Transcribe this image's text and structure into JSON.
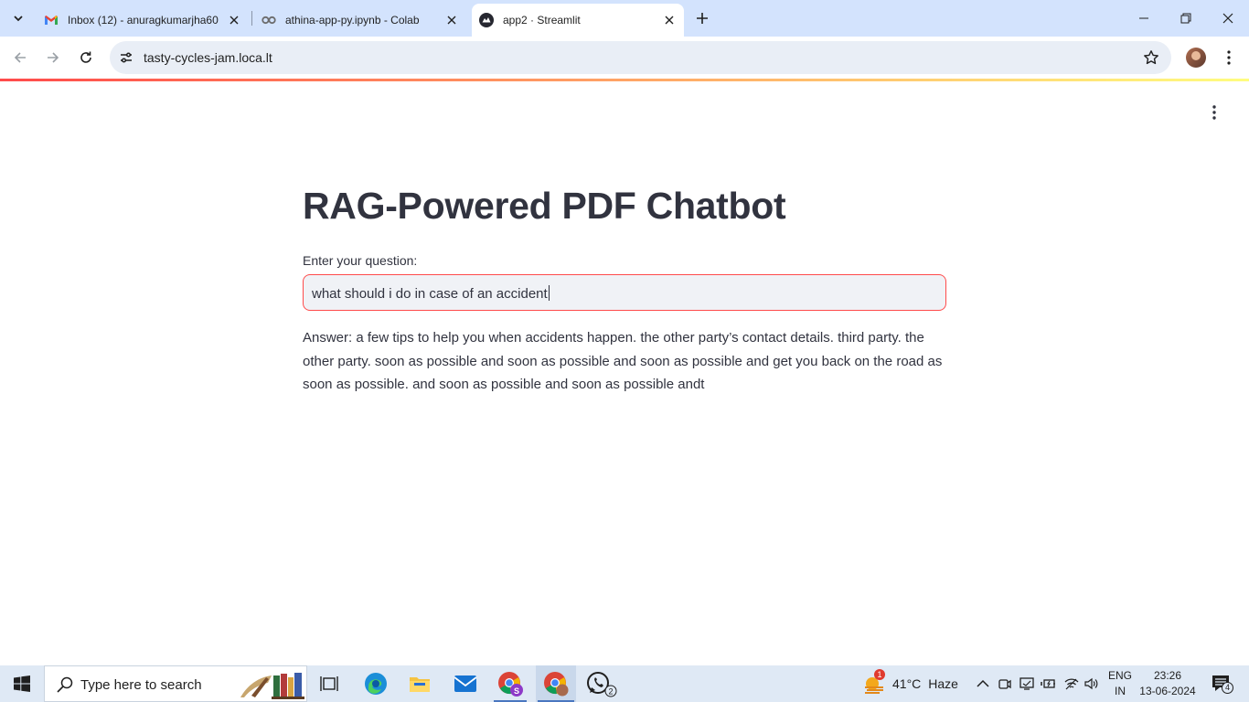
{
  "browser": {
    "tabs": [
      {
        "title": "Inbox (12) - anuragkumarjha60",
        "icon": "gmail-icon",
        "active": false
      },
      {
        "title": "athina-app-py.ipynb - Colab",
        "icon": "colab-icon",
        "active": false
      },
      {
        "title": "app2 · Streamlit",
        "icon": "streamlit-icon",
        "active": true
      }
    ],
    "address": "tasty-cycles-jam.loca.lt"
  },
  "app": {
    "title": "RAG-Powered PDF Chatbot",
    "question_label": "Enter your question:",
    "question_value": "what should i do in case of an accident",
    "answer": "Answer: a few tips to help you when accidents happen. the other party’s contact details. third party. the other party. soon as possible and soon as possible and soon as possible and get you back on the road as soon as possible. and soon as possible and soon as possible andt",
    "accent_color": "#ff4b4b"
  },
  "taskbar": {
    "search_placeholder": "Type here to search",
    "weather_badge": "1",
    "weather_temp": "41°C",
    "weather_desc": "Haze",
    "whatsapp_badge": "2",
    "lang_top": "ENG",
    "lang_bottom": "IN",
    "time": "23:26",
    "date": "13-06-2024",
    "notification_count": "4"
  }
}
